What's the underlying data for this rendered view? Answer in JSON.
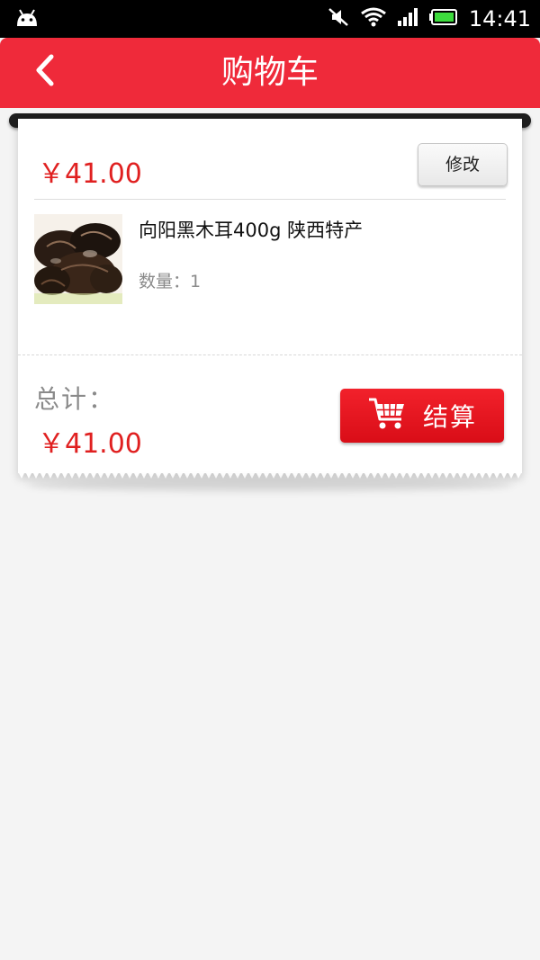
{
  "status_bar": {
    "time": "14:41",
    "icons": [
      "android-notification-icon",
      "mute-icon",
      "wifi-icon",
      "signal-icon",
      "battery-icon"
    ],
    "battery_color": "#3ddc3d"
  },
  "nav": {
    "title": "购物车",
    "back_icon": "chevron-left-icon",
    "background": "#ef2a3a"
  },
  "cart": {
    "items": [
      {
        "price": "￥41.00",
        "edit_label": "修改",
        "name": "向阳黑木耳400g 陕西特产",
        "quantity_text": "数量：1",
        "image": "product-photo-black-fungus"
      }
    ],
    "total_label": "总计：",
    "total_value": "￥41.00",
    "checkout_label": "结算",
    "checkout_icon": "shopping-cart-icon"
  },
  "colors": {
    "accent_red": "#e02020",
    "page_background": "#f4f4f4"
  }
}
